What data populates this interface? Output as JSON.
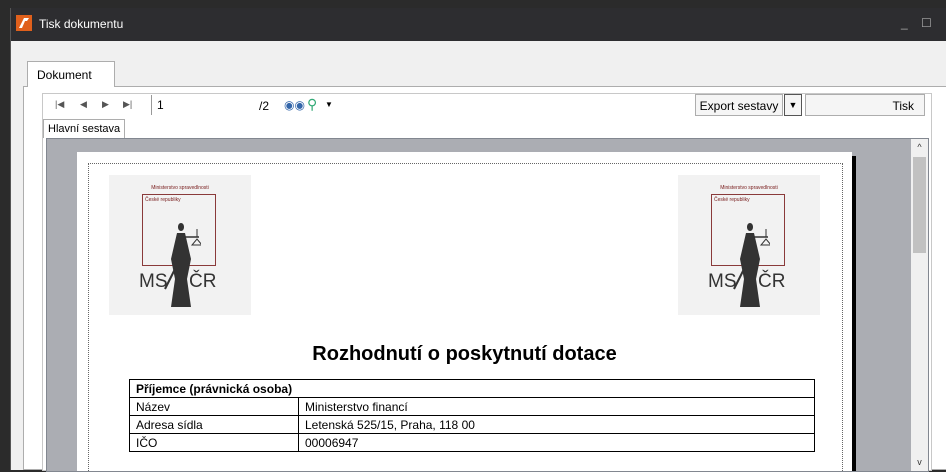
{
  "window": {
    "title": "Tisk dokumentu",
    "minimize": "_",
    "maximize": "☐"
  },
  "tabs": {
    "document": "Dokument"
  },
  "toolbar": {
    "first_icon": "first-page-icon",
    "page": "1",
    "page_total": "/2",
    "export_label": "Export sestavy",
    "export_dropdown": "▼",
    "print_label": "Tisk"
  },
  "report_tabs": {
    "main": "Hlavní sestava"
  },
  "logo": {
    "top_text": "Ministerstvo spravedlnosti",
    "sub_text": "České republiky",
    "left_letters": "MS",
    "right_letters": "ČR"
  },
  "document": {
    "title": "Rozhodnutí o poskytnutí dotace",
    "section_header": "Příjemce (právnická osoba)",
    "rows": [
      {
        "key": "Název",
        "value": "Ministerstvo financí"
      },
      {
        "key": "Adresa sídla",
        "value": "Letenská 525/15, Praha, 118 00"
      },
      {
        "key": "IČO",
        "value": "00006947"
      }
    ]
  }
}
